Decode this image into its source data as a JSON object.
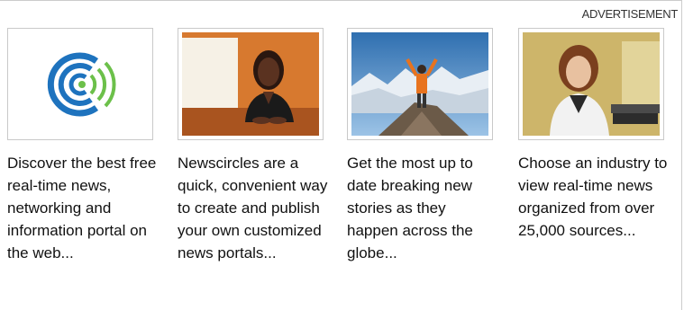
{
  "ad": {
    "label": "ADVERTISEMENT"
  },
  "cards": [
    {
      "image": "logo-concentric-circles",
      "text": "Discover the best free real-time news, networking and information portal on the web..."
    },
    {
      "image": "woman-at-desk-photo",
      "text": "Newscircles are a quick, convenient way to create and publish your own customized news portals..."
    },
    {
      "image": "hiker-on-mountain-photo",
      "text": "Get the most up to date breaking new stories as they happen across the globe..."
    },
    {
      "image": "woman-at-computer-photo",
      "text": "Choose an industry to view real-time news organized from over 25,000 sources..."
    }
  ],
  "colors": {
    "logo_blue": "#1e73be",
    "logo_green": "#6cc04a",
    "sky_blue": "#2f6fb0",
    "jacket_orange": "#e8731e",
    "wall_yellow": "#d9c27a"
  }
}
